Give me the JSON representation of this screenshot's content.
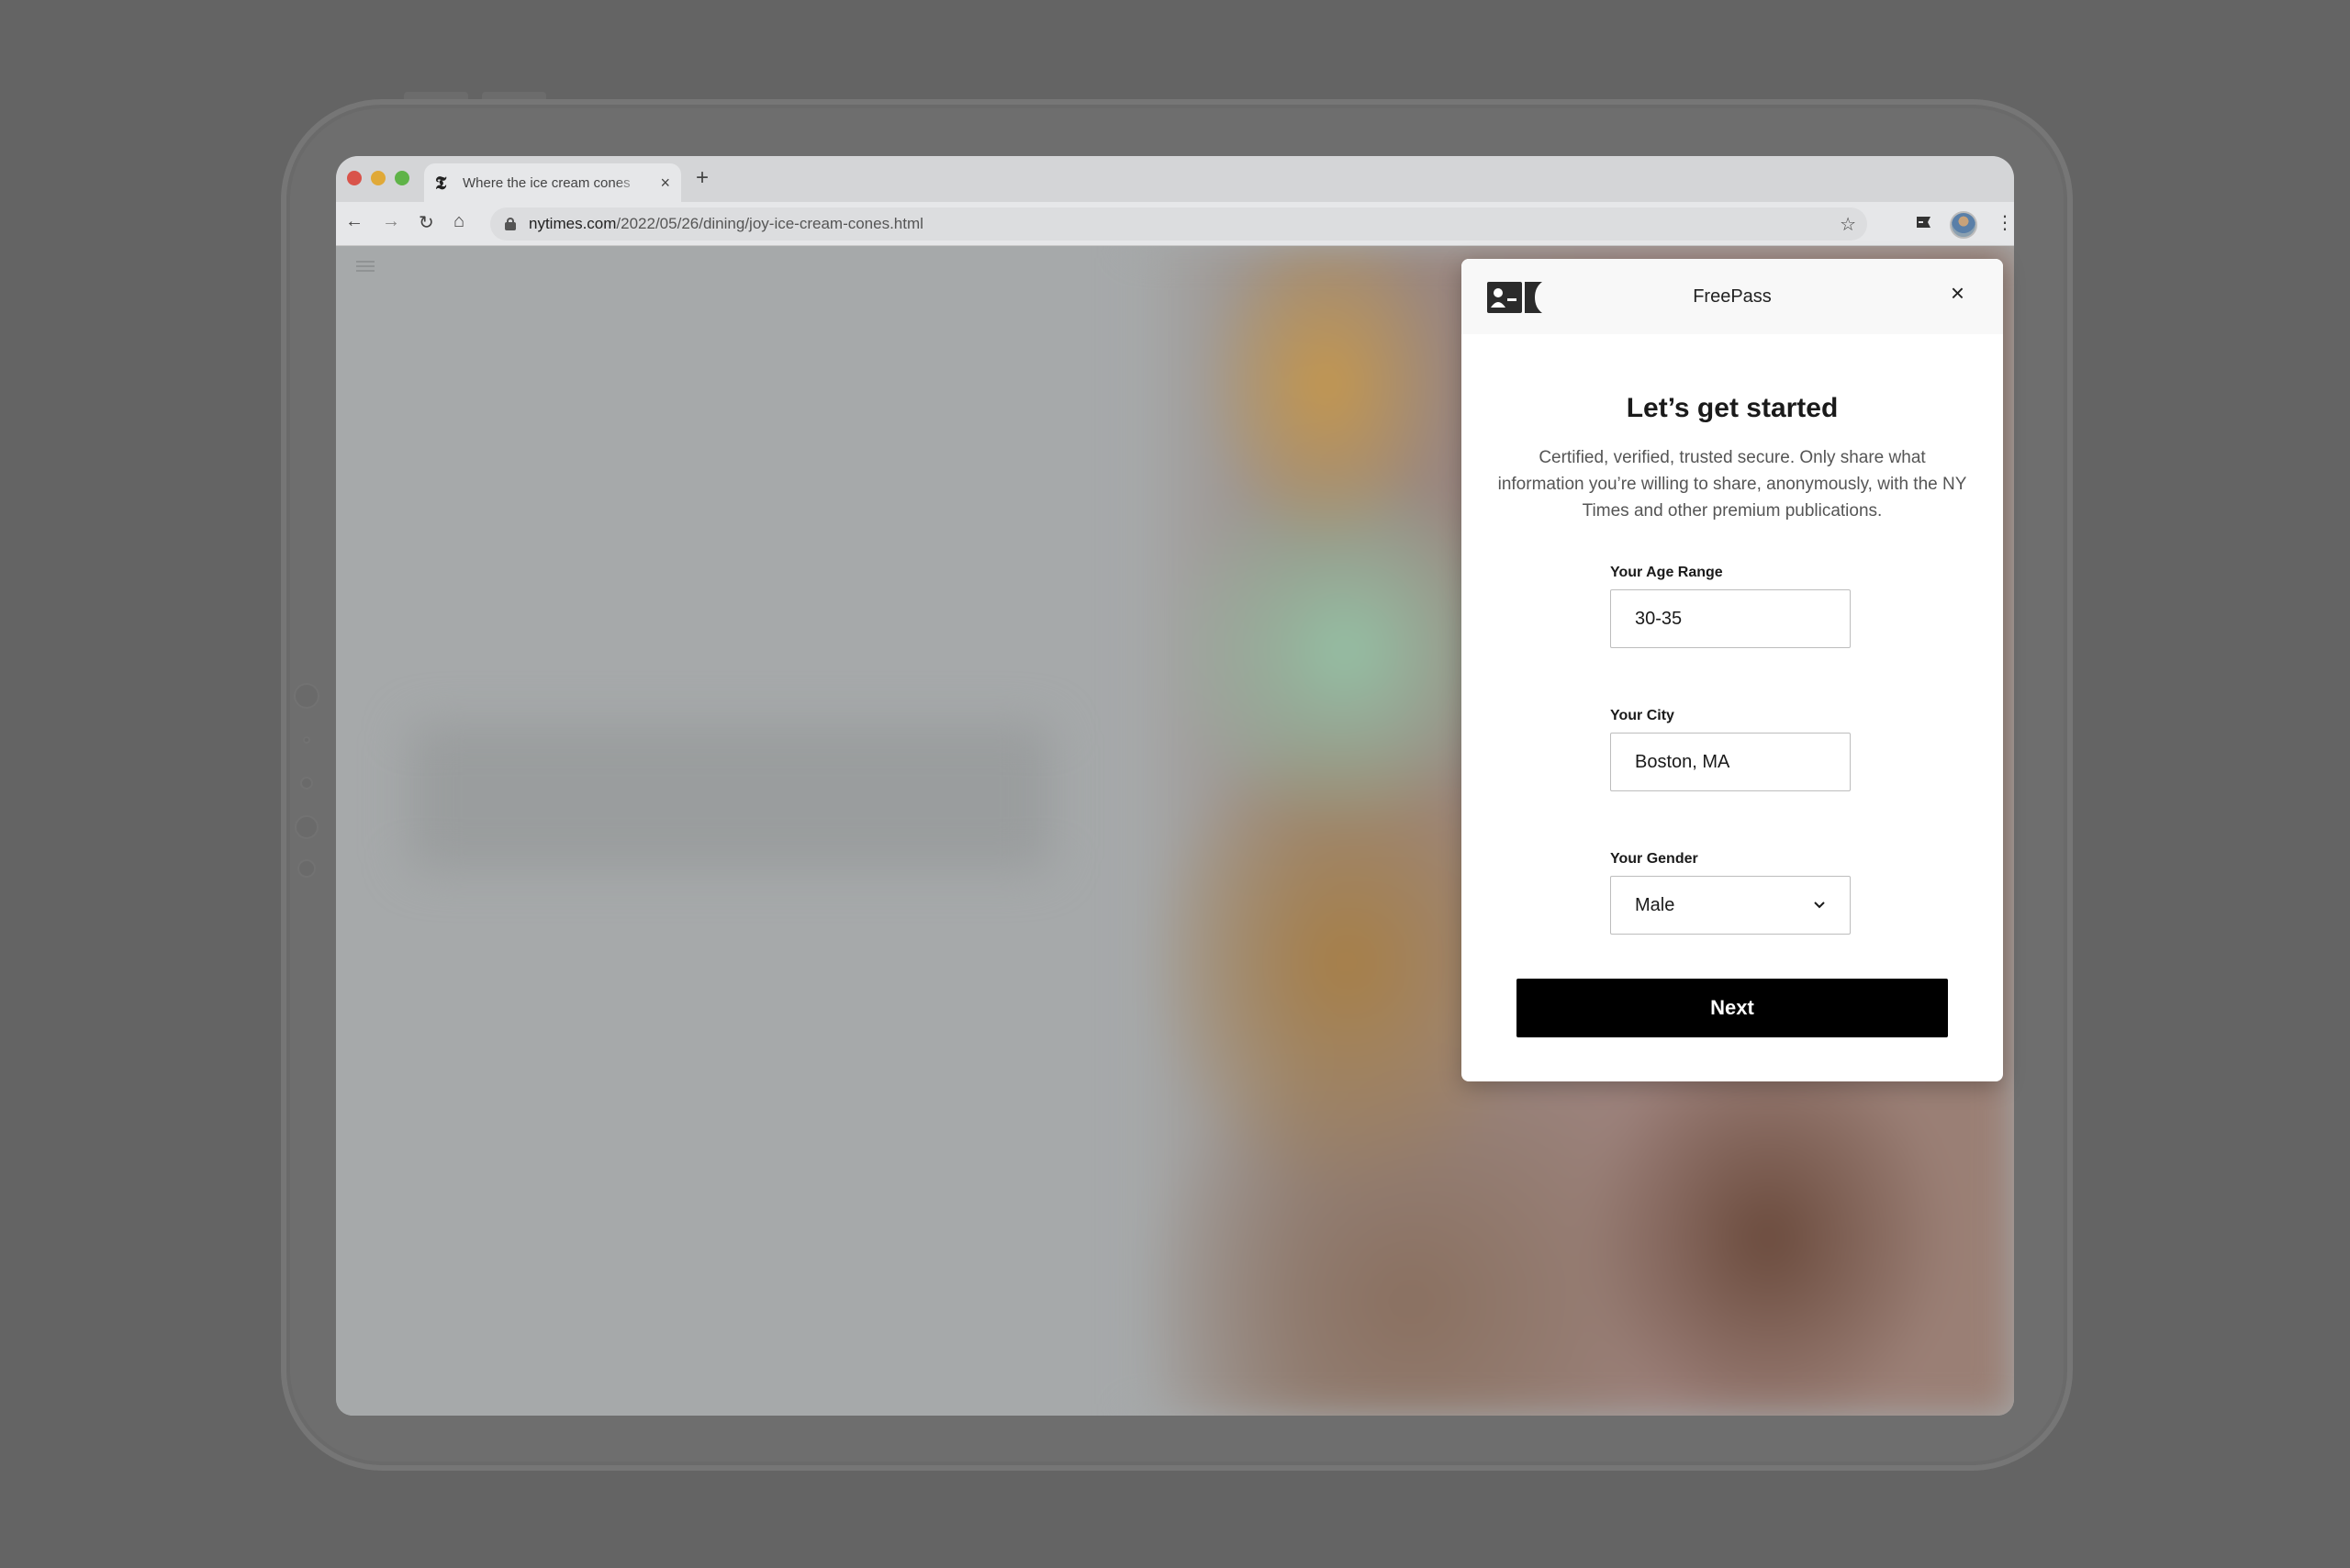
{
  "browser": {
    "tab": {
      "favicon": "𝕿",
      "title": "Where the ice cream cones",
      "close": "×"
    },
    "new_tab": "+",
    "nav": {
      "back": "←",
      "forward": "→",
      "reload": "↻",
      "home": "⌂"
    },
    "url": {
      "domain": "nytimes.com",
      "path": "/2022/05/26/dining/joy-ice-cream-cones.html"
    },
    "star": "☆",
    "menu": "⋮"
  },
  "panel": {
    "brand": "FreePass",
    "close": "×",
    "title": "Let’s get started",
    "description": "Certified, verified, trusted secure. Only share what information you’re willing to share, anonymously, with the NY Times and other premium publications.",
    "fields": {
      "age": {
        "label": "Your Age Range",
        "value": "30-35"
      },
      "city": {
        "label": "Your City",
        "value": "Boston, MA"
      },
      "gender": {
        "label": "Your Gender",
        "value": "Male"
      }
    },
    "next_label": "Next"
  }
}
